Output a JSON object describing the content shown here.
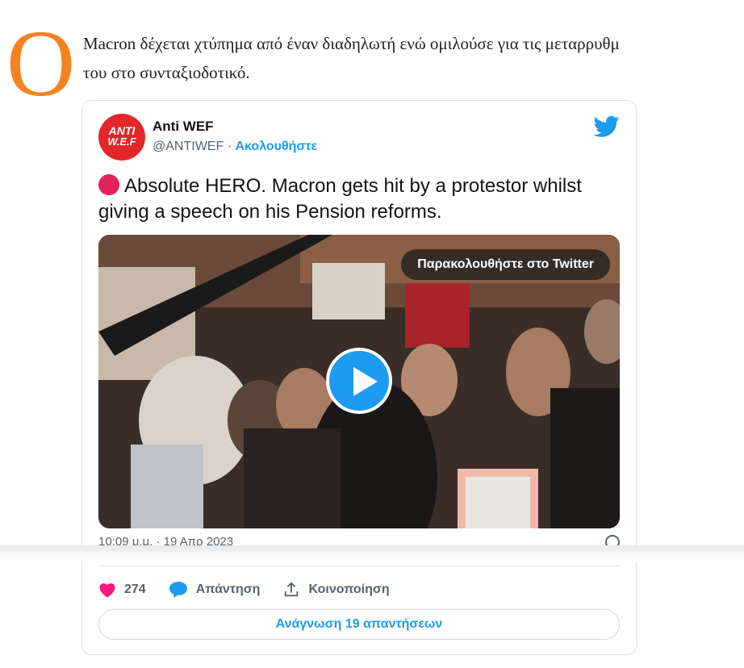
{
  "article": {
    "lead_line1": "Macron δέχεται χτύπημα από έναν διαδηλωτή ενώ ομιλούσε για τις μεταρρυθμ",
    "lead_line2": "του στο συνταξιοδοτικό.",
    "dropcap": "O",
    "dropcap_color": "#f58220"
  },
  "tweet": {
    "avatar_line1": "ANTI",
    "avatar_line2": "W.E.F",
    "author_name": "Anti WEF",
    "handle": "@ANTIWEF",
    "separator": "·",
    "follow_label": "Ακολουθήστε",
    "text": "Absolute HERO. Macron gets hit by a protestor whilst giving a speech on his Pension reforms.",
    "media": {
      "watch_label": "Παρακολουθήστε στο Twitter"
    },
    "timestamp": "10:09 μ.μ. · 19 Απρ 2023",
    "likes": "274",
    "reply_label": "Απάντηση",
    "share_label": "Κοινοποίηση",
    "read_replies_label": "Ανάγνωση 19 απαντήσεων"
  },
  "colors": {
    "twitter_blue": "#1d9bf0",
    "like_pink": "#f91880",
    "avatar_red": "#e3262a"
  },
  "icons": [
    "twitter-bird-icon",
    "red-circle-emoji-icon",
    "play-icon",
    "info-icon",
    "heart-icon",
    "reply-bubble-icon",
    "share-icon"
  ]
}
